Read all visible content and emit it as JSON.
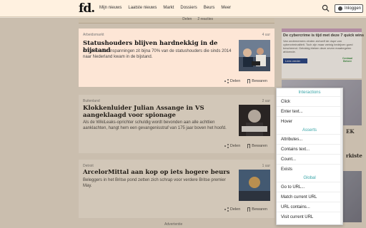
{
  "header": {
    "logo": "fd.",
    "nav": [
      "Mijn nieuws",
      "Laatste nieuws",
      "Markt",
      "Dossiers",
      "Beurs",
      "Meer"
    ],
    "login_label": "Inloggen"
  },
  "top_stub": {
    "share": "Delen",
    "reactions": "2 reacties"
  },
  "articles": [
    {
      "category": "Arbeidsmarkt",
      "time": "4 uur",
      "title": "Statushouders blijven hardnekkig in de bijstand",
      "desc": "Ondanks alle inspanningen zit bijna 70% van de statushouders die sinds 2014 naar Nederland kwam in de bijstand.",
      "share": "Delen",
      "save": "Bewaren"
    },
    {
      "category": "Buitenland",
      "time": "2 uur",
      "title": "Klokkenluider Julian Assange in VS aangeklaagd voor spionage",
      "desc": "Als de WikiLeaks-oprichter schuldig wordt bevonden aan alle achttien aanklachten, hangt hem een gevangenisstraf van 175 jaar boven het hoofd.",
      "share": "Delen",
      "save": "Bewaren"
    },
    {
      "category": "Detroit",
      "time": "1 uur",
      "title": "ArcelorMittal aan kop op iets hogere beurs",
      "desc": "Beleggers in het Britse pond zetten zich schrap voor verdere Britse premier May.",
      "share": "Delen",
      "save": "Bewaren"
    }
  ],
  "advert_label": "Advertentie",
  "ad": {
    "title": "De cybercrime is tijd met deze 7 quick wins",
    "text": "Van ondernemers vinden zichzelf de dupe van cybercriminaliteit. Toch zijn maar weinig bedrijven goed beschermd. Gelukkig bleken deze zeven maatregelen afdoende.",
    "button": "Lees verder",
    "logo": "Centraal Beheer"
  },
  "side_texts": [
    "EK",
    "rkiste"
  ],
  "menu": {
    "interactions_header": "Interactions",
    "interactions": [
      "Click",
      "Enter text...",
      "Hover"
    ],
    "asserts_header": "Asserts",
    "asserts": [
      "Attributes...",
      "Contains text...",
      "Count...",
      "Exists"
    ],
    "global_header": "Global",
    "global": [
      "Go to URL...",
      "Match current URL",
      "URL contains...",
      "Visit current URL"
    ]
  }
}
